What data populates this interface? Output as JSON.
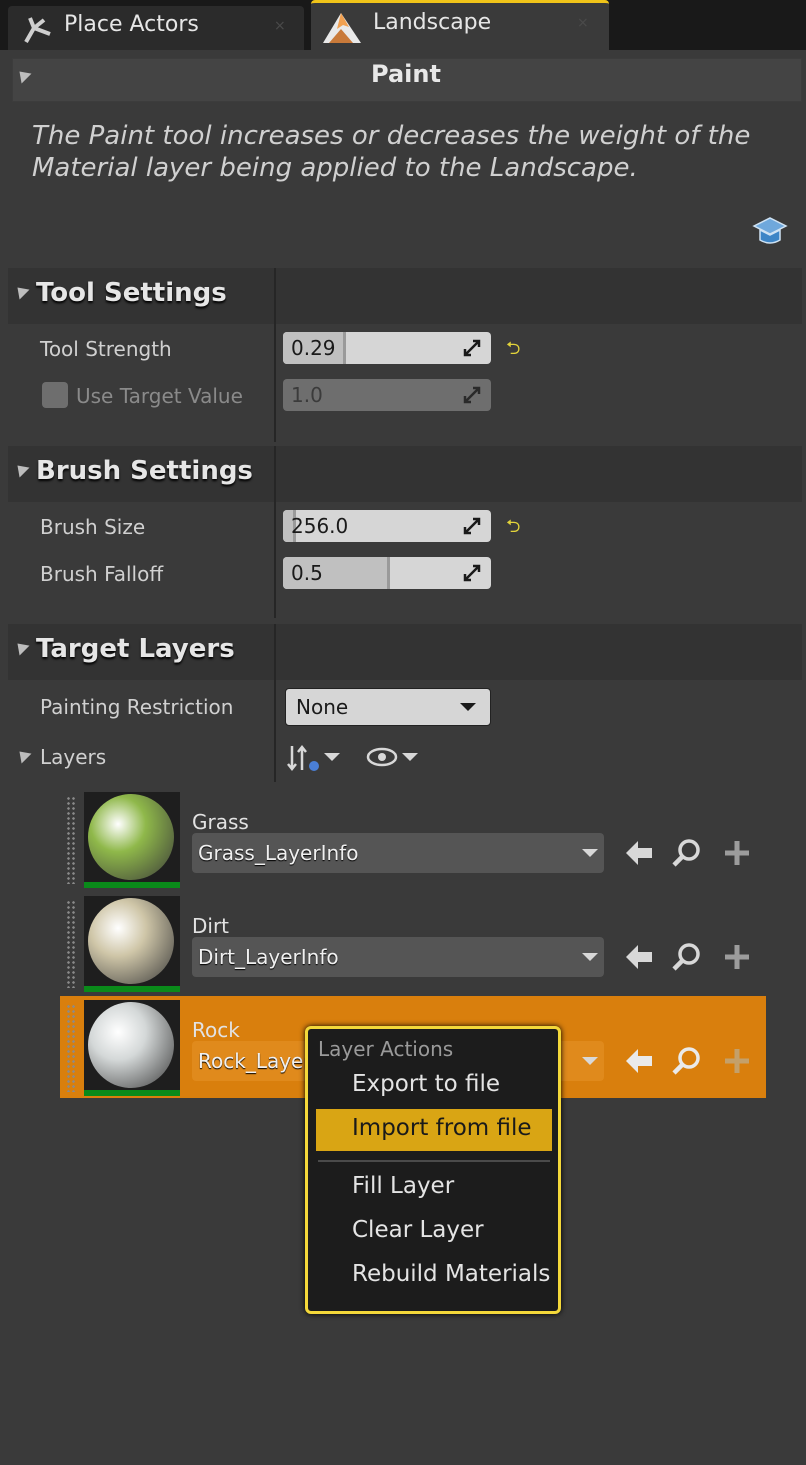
{
  "tabs": [
    {
      "label": "Place Actors",
      "icon": "place-actors-icon",
      "close": "×"
    },
    {
      "label": "Landscape",
      "icon": "landscape-mountain-icon",
      "close": "×",
      "active": true
    }
  ],
  "mode": {
    "title": "Paint",
    "description_line1": "The Paint tool increases or decreases the weight of the",
    "description_line2": "Material layer being applied to the Landscape."
  },
  "tool_settings": {
    "title": "Tool Settings",
    "tool_strength": {
      "label": "Tool Strength",
      "value": "0.29",
      "fraction": 0.29
    },
    "use_target_value": {
      "label": "Use Target Value",
      "value": "1.0",
      "checked": false
    }
  },
  "brush_settings": {
    "title": "Brush Settings",
    "brush_size": {
      "label": "Brush Size",
      "value": "256.0",
      "fraction": 0.05
    },
    "brush_falloff": {
      "label": "Brush Falloff",
      "value": "0.5",
      "fraction": 0.5
    }
  },
  "target_layers": {
    "title": "Target Layers",
    "painting_restriction": {
      "label": "Painting Restriction",
      "value": "None"
    },
    "layers_label": "Layers",
    "layers": [
      {
        "name": "Grass",
        "info": "Grass_LayerInfo",
        "color": "#8fb84a"
      },
      {
        "name": "Dirt",
        "info": "Dirt_LayerInfo",
        "color": "#cfc6a8"
      },
      {
        "name": "Rock",
        "info": "Rock_LayerInfo",
        "color": "#d4d8d8",
        "selected": true
      }
    ]
  },
  "context_menu": {
    "title": "Layer Actions",
    "items": [
      "Export to file",
      "Import from file",
      "Fill Layer",
      "Clear Layer",
      "Rebuild Materials"
    ],
    "highlighted": "Import from file"
  },
  "colors": {
    "accent": "#f0c419",
    "selected_row": "#d97f0d",
    "menu_highlight": "#d9a514"
  }
}
